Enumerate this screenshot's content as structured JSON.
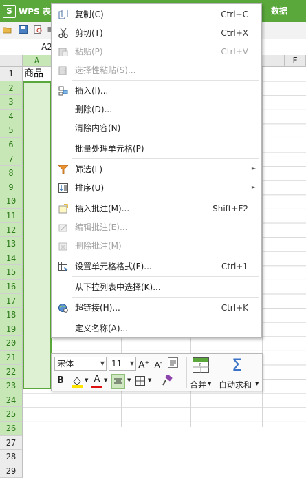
{
  "app": {
    "title": "WPS 表",
    "logo_letter": "S"
  },
  "ribbon": {
    "tab_data": "数据"
  },
  "name_box": "A2",
  "columns": [
    "A",
    "F"
  ],
  "rows": [
    "1",
    "2",
    "3",
    "4",
    "5",
    "6",
    "7",
    "8",
    "9",
    "10",
    "11",
    "12",
    "13",
    "14",
    "15",
    "16",
    "17",
    "18",
    "19",
    "20",
    "21",
    "22",
    "23",
    "24",
    "25",
    "26",
    "27",
    "28",
    "29"
  ],
  "cell_a1": "商品",
  "context_menu": {
    "items": [
      {
        "label": "复制(C)",
        "shortcut": "Ctrl+C",
        "icon": "copy-icon",
        "disabled": false
      },
      {
        "label": "剪切(T)",
        "shortcut": "Ctrl+X",
        "icon": "scissors-icon",
        "disabled": false
      },
      {
        "label": "粘贴(P)",
        "shortcut": "Ctrl+V",
        "icon": "paste-icon",
        "disabled": true
      },
      {
        "label": "选择性粘贴(S)...",
        "shortcut": "",
        "icon": "paste-special-icon",
        "disabled": true
      },
      {
        "label": "插入(I)...",
        "shortcut": "",
        "icon": "insert-cells-icon",
        "disabled": false
      },
      {
        "label": "删除(D)...",
        "shortcut": "",
        "icon": "",
        "disabled": false
      },
      {
        "label": "清除内容(N)",
        "shortcut": "",
        "icon": "",
        "disabled": false
      },
      {
        "label": "批量处理单元格(P)",
        "shortcut": "",
        "icon": "",
        "disabled": false
      },
      {
        "label": "筛选(L)",
        "shortcut": "",
        "icon": "filter-icon",
        "disabled": false
      },
      {
        "label": "排序(U)",
        "shortcut": "",
        "icon": "sort-icon",
        "disabled": false
      },
      {
        "label": "插入批注(M)...",
        "shortcut": "Shift+F2",
        "icon": "insert-comment-icon",
        "disabled": false
      },
      {
        "label": "编辑批注(E)...",
        "shortcut": "",
        "icon": "edit-comment-icon",
        "disabled": true
      },
      {
        "label": "删除批注(M)",
        "shortcut": "",
        "icon": "delete-comment-icon",
        "disabled": true
      },
      {
        "label": "设置单元格格式(F)...",
        "shortcut": "Ctrl+1",
        "icon": "format-cells-icon",
        "disabled": false
      },
      {
        "label": "从下拉列表中选择(K)...",
        "shortcut": "",
        "icon": "",
        "disabled": false
      },
      {
        "label": "超链接(H)...",
        "shortcut": "Ctrl+K",
        "icon": "hyperlink-icon",
        "disabled": false
      },
      {
        "label": "定义名称(A)...",
        "shortcut": "",
        "icon": "",
        "disabled": false
      }
    ]
  },
  "mini_toolbar": {
    "font_name": "宋体",
    "font_size": "11",
    "grow_font": "A",
    "shrink_font": "A",
    "bold": "B",
    "font_color_letter": "A",
    "merge_label": "合并",
    "autosum_label": "自动求和",
    "autosum_symbol": "Σ"
  },
  "colors": {
    "accent": "#5aa83b",
    "selection_fill": "#dff1d3",
    "disabled_text": "#a2a2a2"
  }
}
